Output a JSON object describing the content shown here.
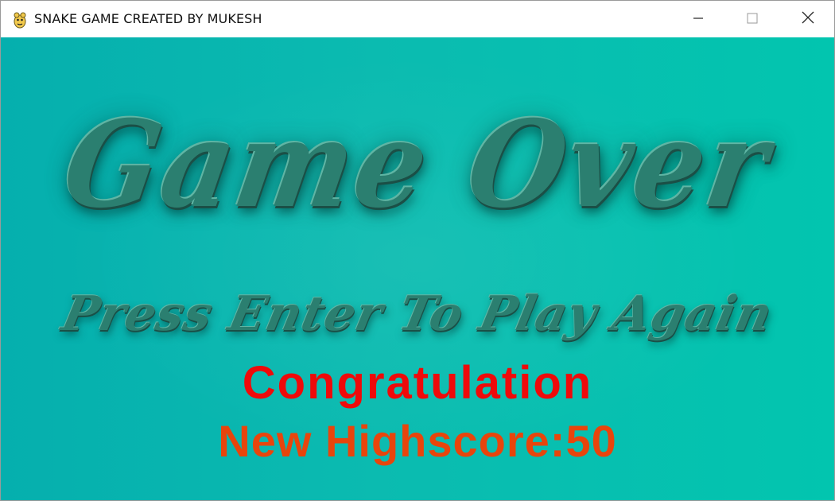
{
  "window": {
    "title": "SNAKE GAME CREATED BY MUKESH",
    "app_icon": "pygame-snake-icon",
    "controls": [
      "minimize-icon",
      "maximize-icon",
      "close-icon"
    ]
  },
  "game": {
    "headline": "Game Over",
    "prompt": "Press Enter To Play Again",
    "congrats": "Congratulation",
    "highscore": "New Highscore:50"
  },
  "colors": {
    "background_left": "#05afae",
    "background_right": "#02c5af",
    "headline": "#2b7f70",
    "congrats": "#ef0a0a",
    "highscore": "#e8450c"
  }
}
